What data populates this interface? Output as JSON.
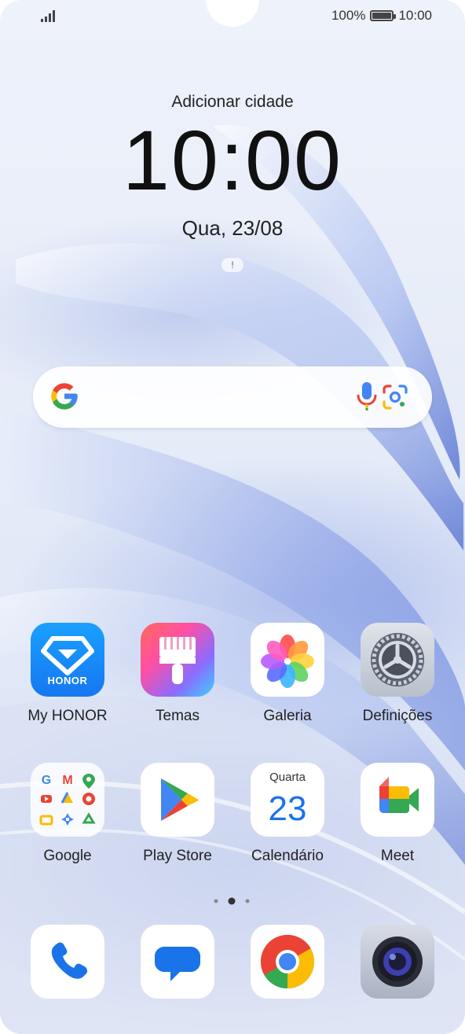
{
  "status_bar": {
    "battery": "100%",
    "battery_level": 1.0,
    "time": "10:00"
  },
  "lock": {
    "city": "Adicionar cidade",
    "time": "10:00",
    "date": "Qua, 23/08"
  },
  "search": {},
  "apps_row1": [
    {
      "label": "My HONOR",
      "icon": "my-honor-icon"
    },
    {
      "label": "Temas",
      "icon": "themes-icon"
    },
    {
      "label": "Galeria",
      "icon": "gallery-icon"
    },
    {
      "label": "Definições",
      "icon": "settings-icon"
    }
  ],
  "apps_row2": [
    {
      "label": "Google",
      "icon": "google-folder-icon"
    },
    {
      "label": "Play Store",
      "icon": "play-store-icon"
    },
    {
      "label": "Calendário",
      "icon": "calendar-icon",
      "day_name": "Quarta",
      "day_number": "23"
    },
    {
      "label": "Meet",
      "icon": "meet-icon"
    }
  ],
  "dock": [
    {
      "icon": "phone-icon"
    },
    {
      "icon": "messages-icon"
    },
    {
      "icon": "chrome-icon"
    },
    {
      "icon": "camera-icon"
    }
  ],
  "honor_badge": "HONOR",
  "colors": {
    "accent_blue": "#2f6bd8",
    "google_blue": "#4285F4",
    "google_red": "#EA4335",
    "google_yellow": "#FBBC05",
    "google_green": "#34A853"
  }
}
